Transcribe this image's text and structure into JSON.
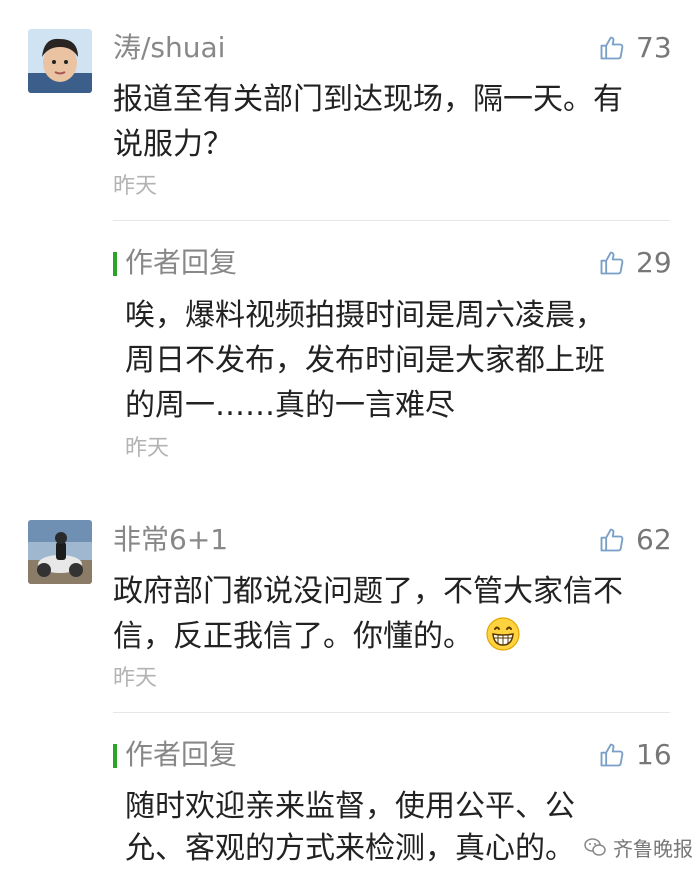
{
  "comments": [
    {
      "author": "涛/shuai",
      "likes": "73",
      "lines": [
        "报道至有关部门到达现场，隔一天。有",
        "说服力？"
      ],
      "time": "昨天",
      "reply": {
        "title": "作者回复",
        "likes": "29",
        "lines": [
          "唉，爆料视频拍摄时间是周六凌晨，",
          "周日不发布，发布时间是大家都上班",
          "的周一……真的一言难尽"
        ],
        "time": "昨天"
      }
    },
    {
      "author": "非常6+1",
      "likes": "62",
      "lines": [
        "政府部门都说没问题了，不管大家信不",
        "信，反正我信了。你懂的。"
      ],
      "time": "昨天",
      "emoji": "grinning-face-emoji",
      "reply": {
        "title": "作者回复",
        "likes": "16",
        "lines": [
          "随时欢迎亲来监督，使用公平、公",
          "允、客观的方式来检测，真心的。"
        ]
      }
    }
  ],
  "watermark": "齐鲁晚报",
  "icons": {
    "like": "thumbs-up-icon",
    "watermark": "wechat-icon"
  },
  "colors": {
    "reply_bar": "#2aa52a",
    "name": "#888888",
    "time": "#b3b3b3"
  }
}
